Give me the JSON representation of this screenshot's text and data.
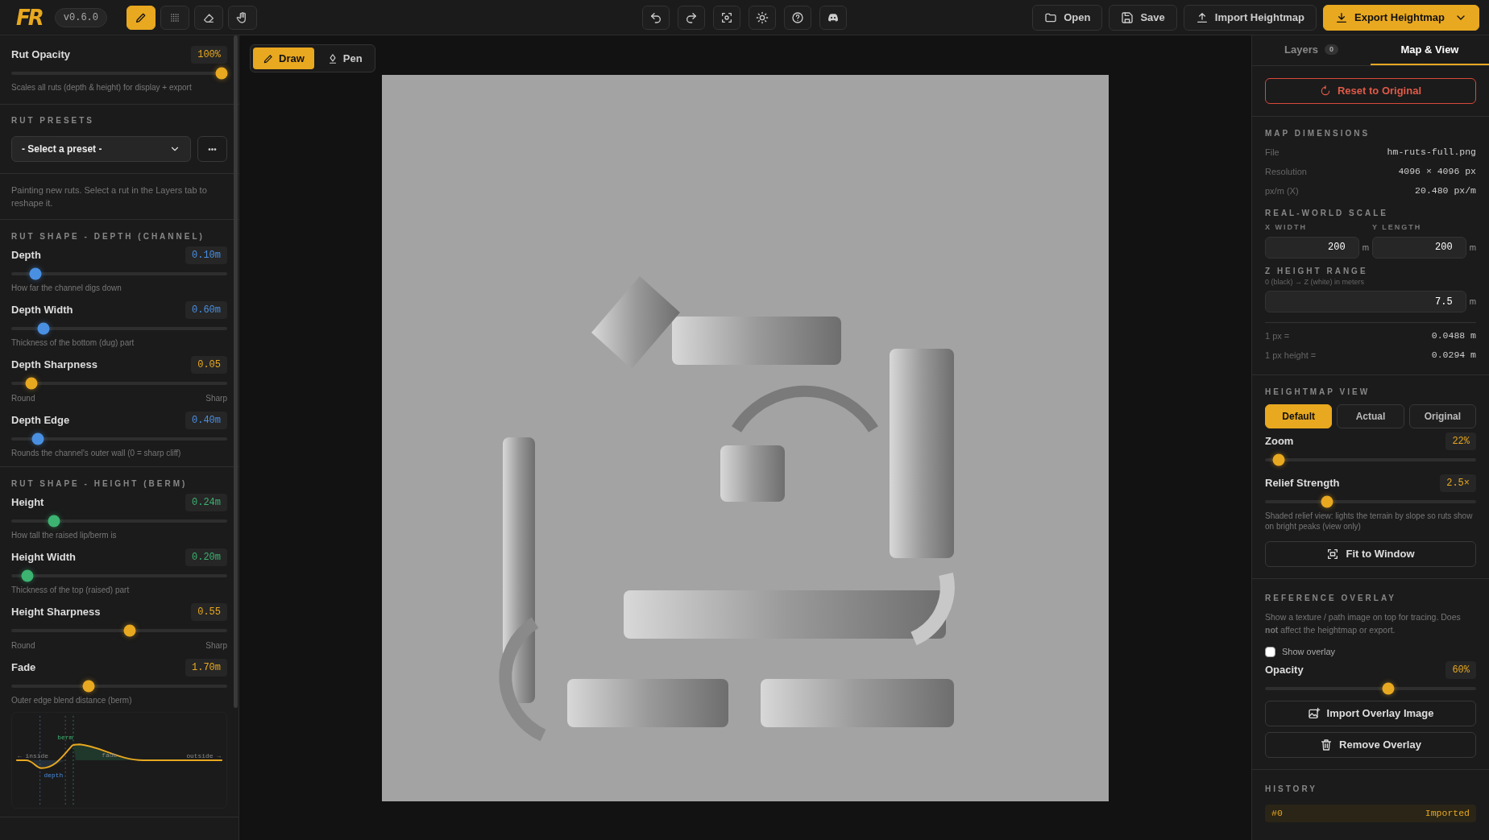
{
  "topbar": {
    "logo": "FR",
    "version": "v0.6.0",
    "tools": [
      {
        "selected": true
      },
      {
        "selected": false
      },
      {
        "selected": false
      },
      {
        "selected": false
      }
    ],
    "buttons": [
      {
        "label": "Open",
        "primary": false
      },
      {
        "label": "Save",
        "primary": false
      },
      {
        "label": "Import Heightmap",
        "primary": false
      },
      {
        "label": "Export Heightmap",
        "primary": true
      }
    ]
  },
  "left": {
    "opacity": {
      "label": "Rut Opacity",
      "value": "100%",
      "level": 1.0,
      "color": "#e8a820",
      "hint": "Scales all ruts (depth & height) for display + export"
    },
    "presets": {
      "heading": "RUT PRESETS",
      "select": "- Select a preset -",
      "more": "•••"
    },
    "note": "Painting new ruts. Select a rut in the Layers tab to reshape it.",
    "sections": [
      {
        "heading": "RUT SHAPE - DEPTH (CHANNEL)",
        "sliders": [
          {
            "label": "Depth",
            "value": "0.10m",
            "level": 0.09,
            "color": "#4a90e2",
            "hint": "How far the channel digs down"
          },
          {
            "label": "Depth Width",
            "value": "0.60m",
            "level": 0.13,
            "color": "#4a90e2",
            "hint": "Thickness of the bottom (dug) part"
          },
          {
            "label": "Depth Sharpness",
            "value": "0.05",
            "level": 0.07,
            "color": "#e8a820",
            "range": [
              "Round",
              "Sharp"
            ]
          },
          {
            "label": "Depth Edge",
            "value": "0.40m",
            "level": 0.1,
            "color": "#4a90e2",
            "hint": "Rounds the channel's outer wall (0 = sharp cliff)"
          }
        ]
      },
      {
        "heading": "RUT SHAPE - HEIGHT (BERM)",
        "sliders": [
          {
            "label": "Height",
            "value": "0.24m",
            "level": 0.18,
            "color": "#3cb371",
            "hint": "How tall the raised lip/berm is"
          },
          {
            "label": "Height Width",
            "value": "0.20m",
            "level": 0.05,
            "color": "#3cb371",
            "hint": "Thickness of the top (raised) part"
          },
          {
            "label": "Height Sharpness",
            "value": "0.55",
            "level": 0.55,
            "color": "#e8a820",
            "range": [
              "Round",
              "Sharp"
            ]
          },
          {
            "label": "Fade",
            "value": "1.70m",
            "level": 0.35,
            "color": "#e8a820",
            "hint": "Outer edge blend distance (berm)"
          }
        ],
        "profile": {
          "inside": "← inside",
          "outside": "outside →",
          "berm": "berm",
          "fade": "fade",
          "depth": "depth"
        }
      }
    ]
  },
  "canvas": {
    "modes": [
      {
        "label": "Draw",
        "selected": true
      },
      {
        "label": "Pen",
        "selected": false
      }
    ]
  },
  "right": {
    "tabs": [
      {
        "label": "Layers",
        "badge": "0",
        "selected": false
      },
      {
        "label": "Map & View",
        "selected": true
      }
    ],
    "reset": "Reset to Original",
    "dimensions": {
      "heading": "MAP DIMENSIONS",
      "rows": [
        {
          "label": "File",
          "value": "hm-ruts-full.png"
        },
        {
          "label": "Resolution",
          "value": "4096 × 4096 px"
        },
        {
          "label": "px/m (X)",
          "value": "20.480 px/m"
        }
      ]
    },
    "scale": {
      "heading": "REAL-WORLD SCALE",
      "fields": [
        {
          "label": "X WIDTH",
          "value": "200",
          "unit": "m"
        },
        {
          "label": "Y LENGTH",
          "value": "200",
          "unit": "m"
        }
      ]
    },
    "zrange": {
      "heading": "Z HEIGHT RANGE",
      "note": "0 (black) → Z (white) in meters",
      "value": "7.5",
      "unit": "m"
    },
    "info": [
      {
        "label": "1 px =",
        "value": "0.0488 m"
      },
      {
        "label": "1 px height =",
        "value": "0.0294 m"
      }
    ],
    "view": {
      "heading": "HEIGHTMAP VIEW",
      "modes": [
        {
          "label": "Default",
          "selected": true
        },
        {
          "label": "Actual",
          "selected": false
        },
        {
          "label": "Original",
          "selected": false
        }
      ],
      "sliders": [
        {
          "label": "Zoom",
          "value": "22%",
          "level": 0.04,
          "color": "#e8a820"
        },
        {
          "label": "Relief Strength",
          "value": "2.5×",
          "level": 0.28,
          "color": "#e8a820",
          "hint": "Shaded relief view: lights the terrain by slope so ruts show on bright peaks (view only)"
        }
      ],
      "fit": "Fit to Window"
    },
    "overlay": {
      "heading": "REFERENCE OVERLAY",
      "text": "Show a texture / path image on top for tracing. Does **not** affect the heightmap or export.",
      "checkbox": {
        "label": "Show overlay",
        "checked": false
      },
      "slider": {
        "label": "Opacity",
        "value": "60%",
        "level": 0.59,
        "color": "#e8a820"
      },
      "import": "Import Overlay Image",
      "remove": "Remove Overlay"
    },
    "history": {
      "heading": "HISTORY",
      "entries": [
        {
          "index": "#0",
          "label": "Imported"
        }
      ]
    }
  }
}
